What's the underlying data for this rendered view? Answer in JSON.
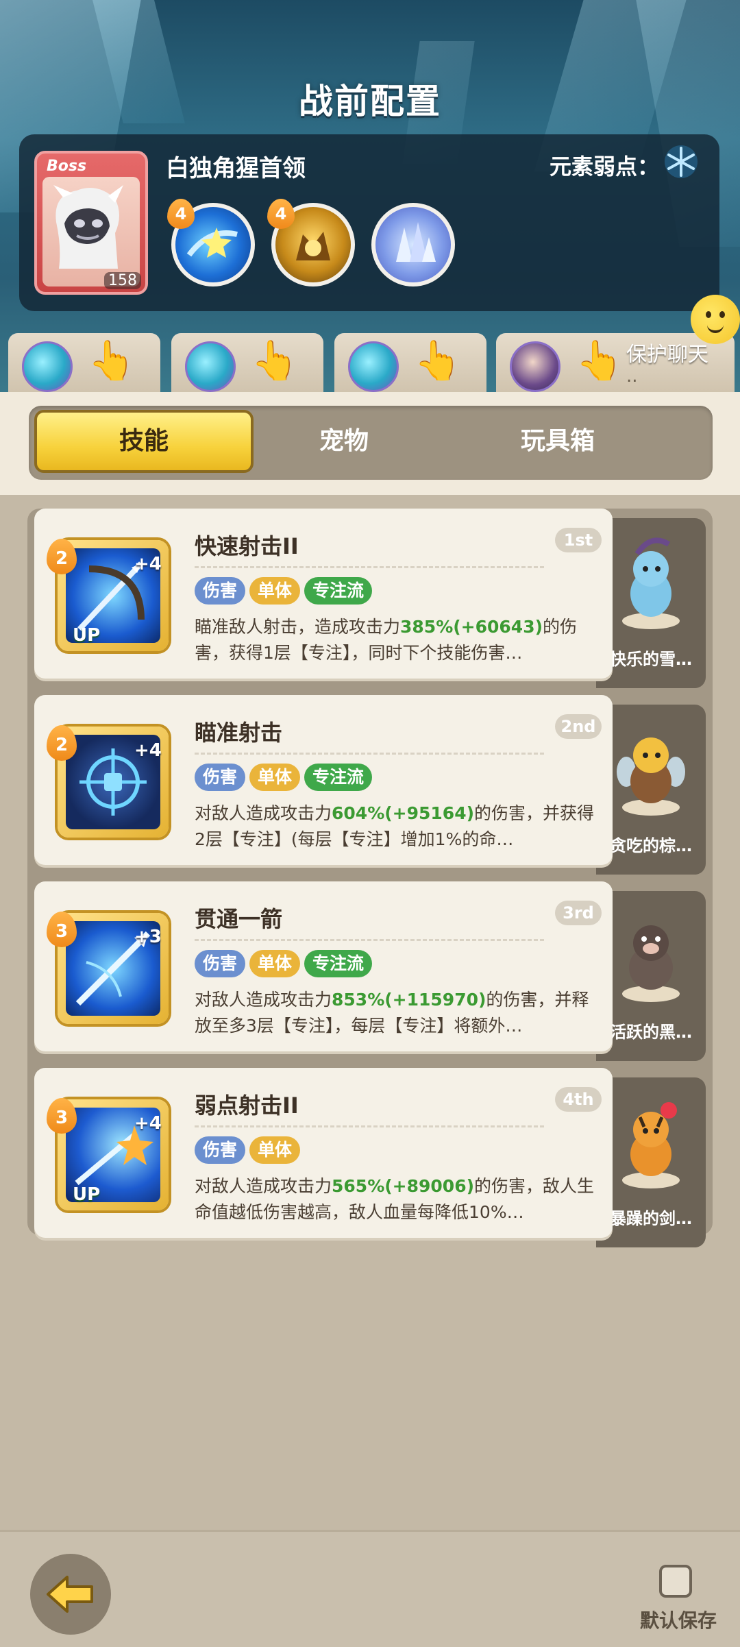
{
  "header": {
    "title": "战前配置"
  },
  "boss": {
    "label": "Boss",
    "name": "白独角猩首领",
    "level": "158",
    "weakness_label": "元素弱点：",
    "weakness_icon": "snowflake-icon",
    "skills": [
      {
        "level": "4",
        "icon": "star-swirl-icon"
      },
      {
        "level": "4",
        "icon": "golden-beast-icon"
      },
      {
        "level": "",
        "icon": "ice-crystal-icon"
      }
    ]
  },
  "team": {
    "slots": [
      {
        "avatar": "blue-hero-avatar"
      },
      {
        "avatar": "blue-hero-avatar"
      },
      {
        "avatar": "blue-hero-avatar"
      },
      {
        "avatar": "purple-hair-avatar"
      }
    ],
    "chat_label": "保护聊天",
    "chat_dots": ".."
  },
  "tabs": [
    {
      "label": "技能",
      "active": true
    },
    {
      "label": "宠物",
      "active": false
    },
    {
      "label": "玩具箱",
      "active": false
    }
  ],
  "skills": [
    {
      "name": "快速射击II",
      "rank": "1st",
      "level": "2",
      "plus": "+4",
      "up": "UP",
      "tags": [
        "伤害",
        "单体",
        "专注流"
      ],
      "desc_pre": "瞄准敌人射击，造成攻击力",
      "pct": "385%(+60643)",
      "desc_post": "的伤害，获得1层【专注】，同时下个技能伤害…",
      "pet_name": "快乐的雪…"
    },
    {
      "name": "瞄准射击",
      "rank": "2nd",
      "level": "2",
      "plus": "+4",
      "up": "",
      "tags": [
        "伤害",
        "单体",
        "专注流"
      ],
      "desc_pre": "对敌人造成攻击力",
      "pct": "604%(+95164)",
      "desc_post": "的伤害，并获得2层【专注】(每层【专注】增加1%的命…",
      "pet_name": "贪吃的棕…"
    },
    {
      "name": "贯通一箭",
      "rank": "3rd",
      "level": "3",
      "plus": "+3",
      "up": "",
      "tags": [
        "伤害",
        "单体",
        "专注流"
      ],
      "desc_pre": "对敌人造成攻击力",
      "pct": "853%(+115970)",
      "desc_post": "的伤害，并释放至多3层【专注】，每层【专注】将额外…",
      "pet_name": "活跃的黑…"
    },
    {
      "name": "弱点射击II",
      "rank": "4th",
      "level": "3",
      "plus": "+4",
      "up": "UP",
      "tags": [
        "伤害",
        "单体"
      ],
      "desc_pre": "对敌人造成攻击力",
      "pct": "565%(+89006)",
      "desc_post": "的伤害，敌人生命值越低伤害越高，敌人血量每降低10%…",
      "pet_name": "暴躁的剑…"
    }
  ],
  "footer": {
    "save_label": "默认保存",
    "back_icon": "back-arrow-icon"
  }
}
